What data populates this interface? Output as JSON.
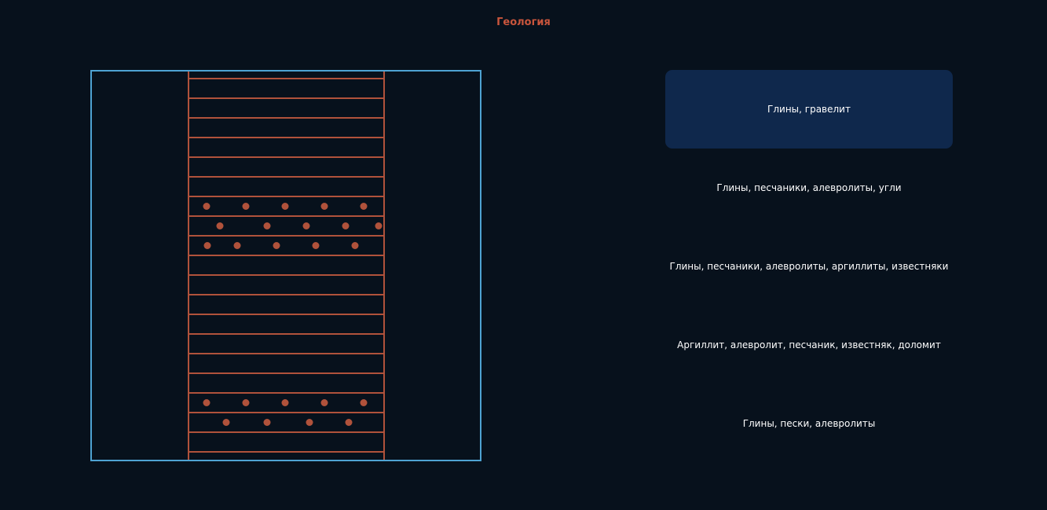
{
  "header": {
    "title": "Геология"
  },
  "colors": {
    "background": "#07111c",
    "title": "#c9553c",
    "pattern": "#b0523b",
    "frame_border": "#4ea3d3",
    "active_layer_bg": "#0f284c",
    "layer_text": "#ffffff"
  },
  "lithology_column": {
    "bands": [
      "clay",
      "clay",
      "clay",
      "clay",
      "clay",
      "clay",
      "gravel",
      "gravel",
      "gravel",
      "clay",
      "clay",
      "clay",
      "clay",
      "clay",
      "clay",
      "clay",
      "gravel",
      "gravel",
      "clay",
      "clay"
    ]
  },
  "layers": {
    "selected_index": 0,
    "items": [
      {
        "label": "Глины, гравелит"
      },
      {
        "label": "Глины, песчаники, алевролиты, угли"
      },
      {
        "label": "Глины, песчаники, алевролиты, аргиллиты, известняки"
      },
      {
        "label": "Аргиллит, алевролит, песчаник, известняк, доломит"
      },
      {
        "label": "Глины, пески, алевролиты"
      }
    ]
  }
}
